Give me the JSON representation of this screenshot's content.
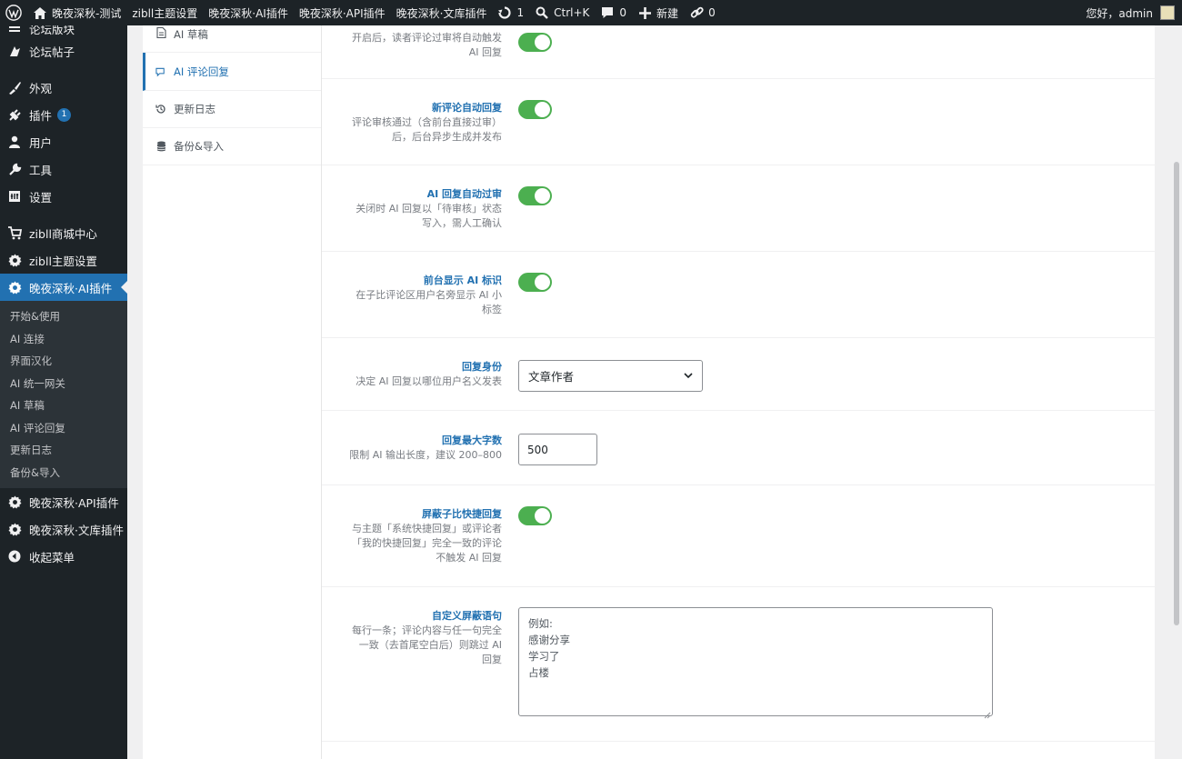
{
  "admin_bar": {
    "site_title": "晚夜深秋-测试",
    "items": [
      "zibll主题设置",
      "晚夜深秋·AI插件",
      "晚夜深秋·API插件",
      "晚夜深秋·文库插件"
    ],
    "updates_count": "1",
    "search_shortcut": "Ctrl+K",
    "comments_count": "0",
    "new_label": "新建",
    "links_count": "0",
    "greeting": "您好，admin"
  },
  "sidebar": {
    "items": [
      {
        "label": "论坛版块",
        "icon": "forum-icon"
      },
      {
        "label": "论坛帖子",
        "icon": "posts-icon"
      },
      {
        "label": "外观",
        "icon": "brush-icon"
      },
      {
        "label": "插件",
        "icon": "plugin-icon",
        "badge": "1"
      },
      {
        "label": "用户",
        "icon": "user-icon"
      },
      {
        "label": "工具",
        "icon": "wrench-icon"
      },
      {
        "label": "设置",
        "icon": "settings-icon"
      },
      {
        "label": "zibll商城中心",
        "icon": "cart-icon"
      },
      {
        "label": "zibll主题设置",
        "icon": "gear-icon"
      },
      {
        "label": "晚夜深秋·AI插件",
        "icon": "gear-icon"
      },
      {
        "label": "晚夜深秋·API插件",
        "icon": "gear-icon"
      },
      {
        "label": "晚夜深秋·文库插件",
        "icon": "gear-icon"
      },
      {
        "label": "收起菜单",
        "icon": "collapse-icon"
      }
    ],
    "submenu": [
      "开始&使用",
      "AI 连接",
      "界面汉化",
      "AI 统一网关",
      "AI 草稿",
      "AI 评论回复",
      "更新日志",
      "备份&导入"
    ]
  },
  "subnav": {
    "items": [
      {
        "label": "AI 草稿",
        "icon": "document-icon"
      },
      {
        "label": "AI 评论回复",
        "icon": "chat-icon"
      },
      {
        "label": "更新日志",
        "icon": "history-icon"
      },
      {
        "label": "备份&导入",
        "icon": "database-icon"
      }
    ],
    "active": "AI 评论回复"
  },
  "settings": {
    "row0": {
      "desc1": "开启后，读者评论过审将自动触发",
      "desc2": "AI 回复",
      "enabled": true
    },
    "row1": {
      "title": "新评论自动回复",
      "desc1": "评论审核通过（含前台直接过审）",
      "desc2": "后，后台异步生成并发布",
      "enabled": true
    },
    "row2": {
      "title": "AI 回复自动过审",
      "desc1": "关闭时 AI 回复以「待审核」状态",
      "desc2": "写入，需人工确认",
      "enabled": true
    },
    "row3": {
      "title": "前台显示 AI 标识",
      "desc1": "在子比评论区用户名旁显示 AI 小",
      "desc2": "标签",
      "enabled": true
    },
    "row4": {
      "title": "回复身份",
      "desc1": "决定 AI 回复以哪位用户名义发表",
      "value": "文章作者"
    },
    "row5": {
      "title": "回复最大字数",
      "desc1": "限制 AI 输出长度，建议 200–800",
      "value": "500"
    },
    "row6": {
      "title": "屏蔽子比快捷回复",
      "desc1": "与主题「系统快捷回复」或评论者",
      "desc2": "「我的快捷回复」完全一致的评论",
      "desc3": "不触发 AI 回复",
      "enabled": true
    },
    "row7": {
      "title": "自定义屏蔽语句",
      "desc1": "每行一条；评论内容与任一句完全",
      "desc2": "一致（去首尾空白后）则跳过 AI",
      "desc3": "回复",
      "lines": [
        "例如:",
        "感谢分享",
        "学习了",
        "占楼"
      ]
    }
  },
  "colors": {
    "accent": "#2271b1",
    "toggle_on": "#4caf50",
    "adminbar": "#1d2327"
  }
}
